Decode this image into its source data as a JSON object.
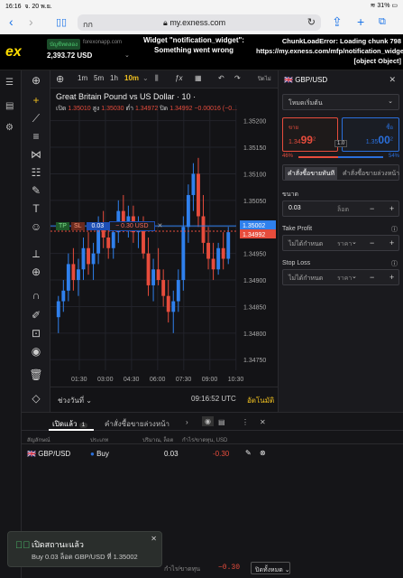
{
  "ios": {
    "time": "16:16",
    "date": "จ. 20 พ.ย.",
    "battery": "31%"
  },
  "browser": {
    "text_size": "กก",
    "host": "my.exness.com",
    "lock_icon": "lock-icon"
  },
  "app": {
    "logo": "ex",
    "account_type": "บัญชีทดลอง",
    "server": "forexonapp.com",
    "balance": "2,393.72 USD",
    "error_widget": "Widget \"notification_widget\": Something went wrong",
    "error_chunk": "ChunkLoadError: Loading chunk 798 https://my.exness.com/mfp/notification_widget [object Object]"
  },
  "chart_toolbar": {
    "timeframes": [
      "1m",
      "5m",
      "1h",
      "10m"
    ],
    "active": "10m",
    "indicators": "ƒx",
    "session": "ปิดไม่"
  },
  "chart_data": {
    "type": "candlestick",
    "title": "Great Britain Pound vs US Dollar · 10 ·",
    "ohlc_line": {
      "open_label": "เปิด",
      "open": "1.35010",
      "high_label": "สูง",
      "high": "1.35030",
      "low_label": "ต่ำ",
      "low": "1.34972",
      "close_label": "ปิด",
      "close": "1.34992",
      "change": "−0.00016 (−0..."
    },
    "x_ticks": [
      "01:30",
      "03:00",
      "04:30",
      "06:00",
      "07:30",
      "09:00",
      "10:30"
    ],
    "y_ticks": [
      "1.35200",
      "1.35150",
      "1.35100",
      "1.35050",
      "1.35000",
      "1.34950",
      "1.34900",
      "1.34850",
      "1.34800",
      "1.34750"
    ],
    "ylim": [
      1.3473,
      1.3523
    ],
    "ask_label": "1.35002",
    "bid_label": "1.34992",
    "candles": [
      [
        1.3483,
        1.3487,
        1.348,
        1.3486
      ],
      [
        1.3486,
        1.349,
        1.3484,
        1.3488
      ],
      [
        1.3488,
        1.3495,
        1.3486,
        1.3493
      ],
      [
        1.3493,
        1.3496,
        1.3488,
        1.349
      ],
      [
        1.349,
        1.3494,
        1.3487,
        1.3492
      ],
      [
        1.3492,
        1.3498,
        1.349,
        1.3496
      ],
      [
        1.3496,
        1.3499,
        1.3491,
        1.3493
      ],
      [
        1.3493,
        1.3497,
        1.349,
        1.3495
      ],
      [
        1.3495,
        1.3502,
        1.3493,
        1.35
      ],
      [
        1.35,
        1.3503,
        1.3496,
        1.3498
      ],
      [
        1.3498,
        1.35,
        1.3494,
        1.3496
      ],
      [
        1.3496,
        1.3501,
        1.3494,
        1.3499
      ],
      [
        1.3499,
        1.3505,
        1.3497,
        1.3503
      ],
      [
        1.3503,
        1.3506,
        1.3499,
        1.3501
      ],
      [
        1.3501,
        1.3504,
        1.3498,
        1.3502
      ],
      [
        1.3502,
        1.3504,
        1.3497,
        1.3499
      ],
      [
        1.3499,
        1.3502,
        1.3496,
        1.35
      ],
      [
        1.35,
        1.3502,
        1.3494,
        1.3495
      ],
      [
        1.3495,
        1.3498,
        1.3487,
        1.3489
      ],
      [
        1.3489,
        1.3494,
        1.3486,
        1.3492
      ],
      [
        1.3492,
        1.3496,
        1.3489,
        1.349
      ],
      [
        1.349,
        1.3492,
        1.3485,
        1.3487
      ],
      [
        1.3487,
        1.349,
        1.3482,
        1.3484
      ],
      [
        1.3484,
        1.3488,
        1.348,
        1.3486
      ],
      [
        1.3486,
        1.3492,
        1.3484,
        1.349
      ],
      [
        1.349,
        1.3502,
        1.3488,
        1.35
      ],
      [
        1.35,
        1.3508,
        1.3497,
        1.3506
      ],
      [
        1.3506,
        1.3512,
        1.3503,
        1.351
      ],
      [
        1.351,
        1.3513,
        1.35,
        1.3502
      ],
      [
        1.3502,
        1.3506,
        1.3495,
        1.3497
      ],
      [
        1.3497,
        1.35,
        1.3492,
        1.3494
      ],
      [
        1.3494,
        1.3497,
        1.349,
        1.3492
      ],
      [
        1.3492,
        1.3497,
        1.3491,
        1.3496
      ],
      [
        1.3496,
        1.3499,
        1.3492,
        1.3494
      ],
      [
        1.3494,
        1.35,
        1.3493,
        1.3499
      ]
    ]
  },
  "trade_overlay": {
    "tp": "TP",
    "sl": "SL",
    "volume": "0.03",
    "pnl": "− 0.30 USD"
  },
  "chart_footer": {
    "range": "ช่วงวันที่",
    "clock": "09:16:52 UTC",
    "auto": "อัตโนมัติ"
  },
  "order_panel": {
    "symbol": "GBP/USD",
    "mode": "โหมดเริ่มต้น",
    "sell_label": "ขาย",
    "sell_price_main": "1.34",
    "sell_price_big": "99",
    "sell_price_frac": "2",
    "buy_label": "ซื้อ",
    "buy_price_main": "1.35",
    "buy_price_big": "00",
    "buy_price_frac": "2",
    "spread": "1.0",
    "sell_pct": "46%",
    "buy_pct": "54%",
    "tab_market": "คำสั่งซื้อขายทันที",
    "tab_pending": "คำสั่งซื้อขายล่วงหน้า",
    "volume_label": "ขนาด",
    "volume_value": "0.03",
    "volume_unit": "ล็อต",
    "tp_label": "Take Profit",
    "tp_value": "ไม่ได้กำหนด",
    "tp_unit": "ราคา",
    "sl_label": "Stop Loss",
    "sl_value": "ไม่ได้กำหนด",
    "sl_unit": "ราคา"
  },
  "positions": {
    "tab_open": "เปิดแล้ว",
    "open_count": "1",
    "tab_pending": "คำสั่งซื้อขายล่วงหน้า",
    "columns": [
      "สัญลักษณ์",
      "ประเภท",
      "ปริมาณ, ล็อต",
      "กำไร/ขาดทุน, USD"
    ],
    "rows": [
      {
        "symbol": "GBP/USD",
        "type": "Buy",
        "volume": "0.03",
        "pnl": "-0.30"
      }
    ]
  },
  "toast": {
    "title": "เปิดสถานะแล้ว",
    "body": "Buy 0.03 ล็อต GBP/USD ที่ 1.35002"
  },
  "bottombar": {
    "label": "กำไร/ขาดทุน",
    "value": "−0.30",
    "close_all": "ปิดทั้งหมด"
  }
}
